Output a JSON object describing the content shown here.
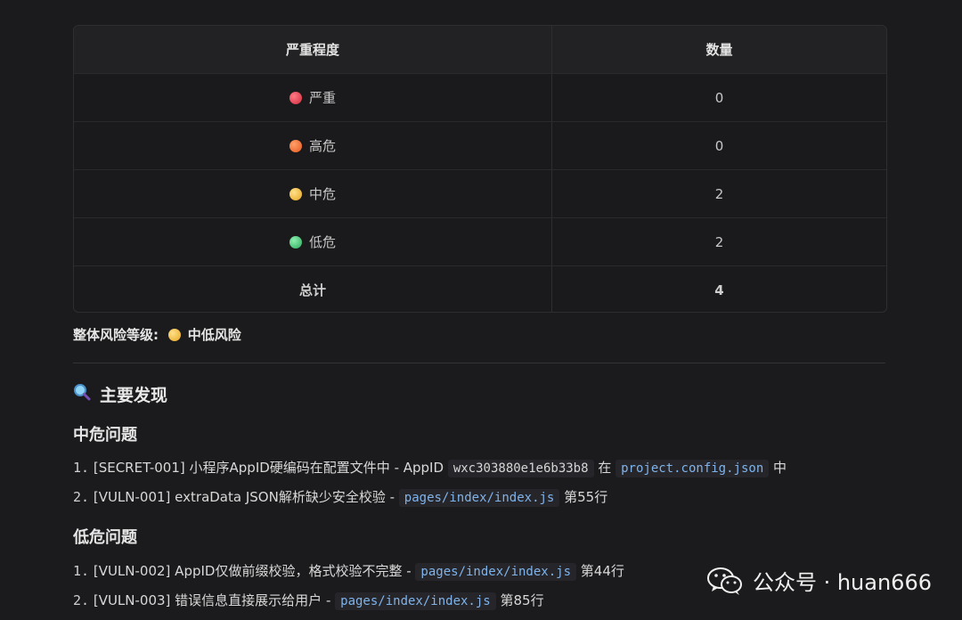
{
  "table": {
    "headers": [
      "严重程度",
      "数量"
    ],
    "rows": [
      {
        "label": "严重",
        "count": "0",
        "color": "#e23b4a"
      },
      {
        "label": "高危",
        "count": "0",
        "color": "#f06a2b"
      },
      {
        "label": "中危",
        "count": "2",
        "color": "#f2b93a"
      },
      {
        "label": "低危",
        "count": "2",
        "color": "#3fc16e"
      }
    ],
    "total_label": "总计",
    "total_count": "4"
  },
  "overall": {
    "label": "整体风险等级:",
    "value": "中低风险",
    "color": "#f2b93a"
  },
  "findings": {
    "title": "主要发现",
    "icon": "magnifier-icon",
    "medium": {
      "heading": "中危问题",
      "items": [
        {
          "num": "1.",
          "text": "[SECRET-001] 小程序AppID硬编码在配置文件中 - AppID",
          "code1": "wxc303880e1e6b33b8",
          "mid": "在",
          "code2": "project.config.json",
          "tail": "中"
        },
        {
          "num": "2.",
          "text": "[VULN-001] extraData JSON解析缺少安全校验 -",
          "code": "pages/index/index.js",
          "tail": "第55行"
        }
      ]
    },
    "low": {
      "heading": "低危问题",
      "items": [
        {
          "num": "1.",
          "text": "[VULN-002] AppID仅做前缀校验，格式校验不完整 -",
          "code": "pages/index/index.js",
          "tail": "第44行"
        },
        {
          "num": "2.",
          "text": "[VULN-003] 错误信息直接展示给用户 -",
          "code": "pages/index/index.js",
          "tail": "第85行"
        }
      ]
    }
  },
  "watermark": {
    "text": "公众号 · huan666",
    "icon": "wechat-icon"
  }
}
